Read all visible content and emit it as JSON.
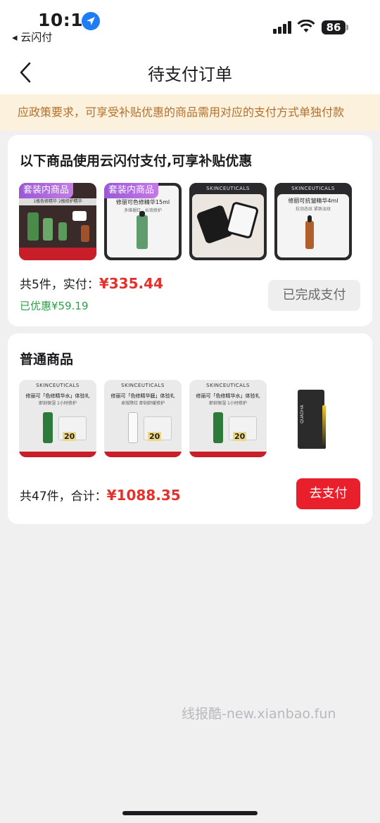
{
  "status_bar": {
    "time": "10:16",
    "back_app": "◂ 云闪付",
    "battery": "86"
  },
  "nav": {
    "title": "待支付订单"
  },
  "notice": {
    "text": "应政策要求，可享受补贴优惠的商品需用对应的支付方式单独付款"
  },
  "subsidy_order": {
    "title": "以下商品使用云闪付支付,可享补贴优惠",
    "items": [
      {
        "tag": "套装内商品",
        "caption": "1瓶色修精华 2瓶修护精华"
      },
      {
        "tag": "套装内商品",
        "brand": "SKINCEUTICALS",
        "caption": "修丽可色修精华15ml",
        "subcaption": "多维褪红 · 长效修护"
      },
      {
        "brand": "SKINCEUTICALS"
      },
      {
        "brand": "SKINCEUTICALS",
        "caption": "修丽可抗皱精华4ml",
        "subcaption": "抗动态纹 紧致淡纹"
      }
    ],
    "count_label": "共5件，实付：",
    "price": "¥335.44",
    "saving": "已优惠¥59.19",
    "button": "已完成支付"
  },
  "normal_order": {
    "title": "普通商品",
    "items": [
      {
        "brand": "SKINCEUTICALS",
        "caption": "修丽可「色修精华水」体验礼",
        "subcaption": "即刻保湿 1小时修护",
        "badge": "20"
      },
      {
        "brand": "SKINCEUTICALS",
        "caption": "修丽可「色修精华膜」体验礼",
        "subcaption": "卓效降红 即刻舒缓修护",
        "badge": "20"
      },
      {
        "brand": "SKINCEUTICALS",
        "caption": "修丽可「色修精华水」体验礼",
        "subcaption": "即刻保湿 1小时修护",
        "badge": "20"
      },
      {
        "brand": "QUADHA"
      }
    ],
    "count_label": "共47件，合计：",
    "price": "¥1088.35",
    "button": "去支付"
  },
  "watermark": "线报酷-new.xianbao.fun",
  "colors": {
    "accent_red": "#ea1f2c",
    "price_red": "#e8302b",
    "saving_green": "#2ba246",
    "notice_bg": "#fcf1dc",
    "notice_text": "#b3702c"
  },
  "icons": [
    "location-arrow-icon",
    "signal-icon",
    "wifi-icon",
    "battery-icon",
    "back-chevron-icon"
  ]
}
